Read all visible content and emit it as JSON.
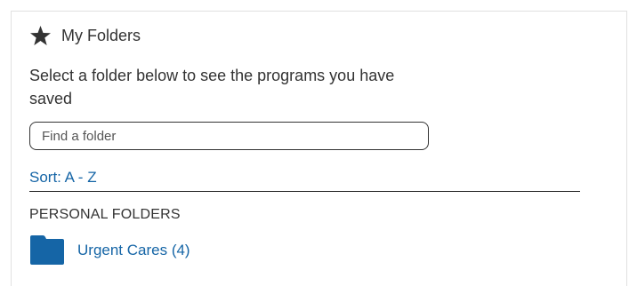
{
  "panel": {
    "header": {
      "icon": "star-icon",
      "title": "My Folders"
    },
    "description": "Select a folder below to see the programs you have saved",
    "search": {
      "placeholder": "Find a folder",
      "value": ""
    },
    "sort": {
      "label": "Sort: A - Z"
    },
    "sections": [
      {
        "heading": "PERSONAL FOLDERS",
        "folders": [
          {
            "icon": "folder-icon",
            "label": "Urgent Cares (4)"
          }
        ]
      }
    ]
  },
  "colors": {
    "link": "#1565a6",
    "folder_icon": "#1565a6",
    "text": "#333333",
    "border": "#e1e1e1"
  }
}
